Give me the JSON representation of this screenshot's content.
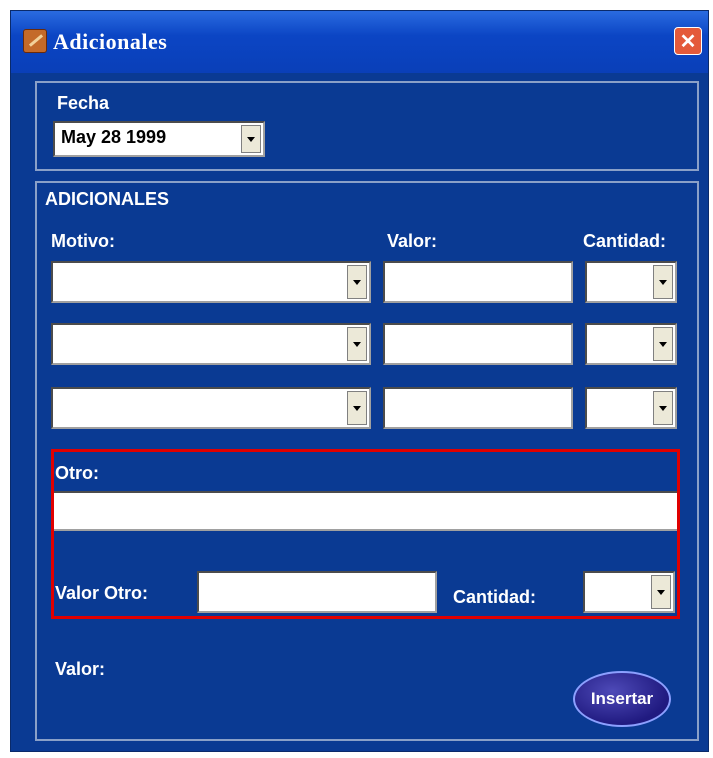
{
  "window": {
    "title": "Adicionales",
    "close_label": "✕"
  },
  "fecha": {
    "label": "Fecha",
    "value": "May 28 1999"
  },
  "adicionales": {
    "group_label": "ADICIONALES",
    "col_motivo": "Motivo:",
    "col_valor": "Valor:",
    "col_cantidad": "Cantidad:",
    "rows": [
      {
        "motivo": "",
        "valor": "",
        "cantidad": ""
      },
      {
        "motivo": "",
        "valor": "",
        "cantidad": ""
      },
      {
        "motivo": "",
        "valor": "",
        "cantidad": ""
      }
    ],
    "otro_label": "Otro:",
    "otro_value": "",
    "valor_otro_label": "Valor Otro:",
    "valor_otro_value": "",
    "cantidad_label": "Cantidad:",
    "cantidad_value": "",
    "valor_label": "Valor:",
    "insert_label": "Insertar"
  },
  "colors": {
    "panel": "#0a3a93",
    "title_bar": "#0b45c4",
    "highlight": "#e00000"
  }
}
